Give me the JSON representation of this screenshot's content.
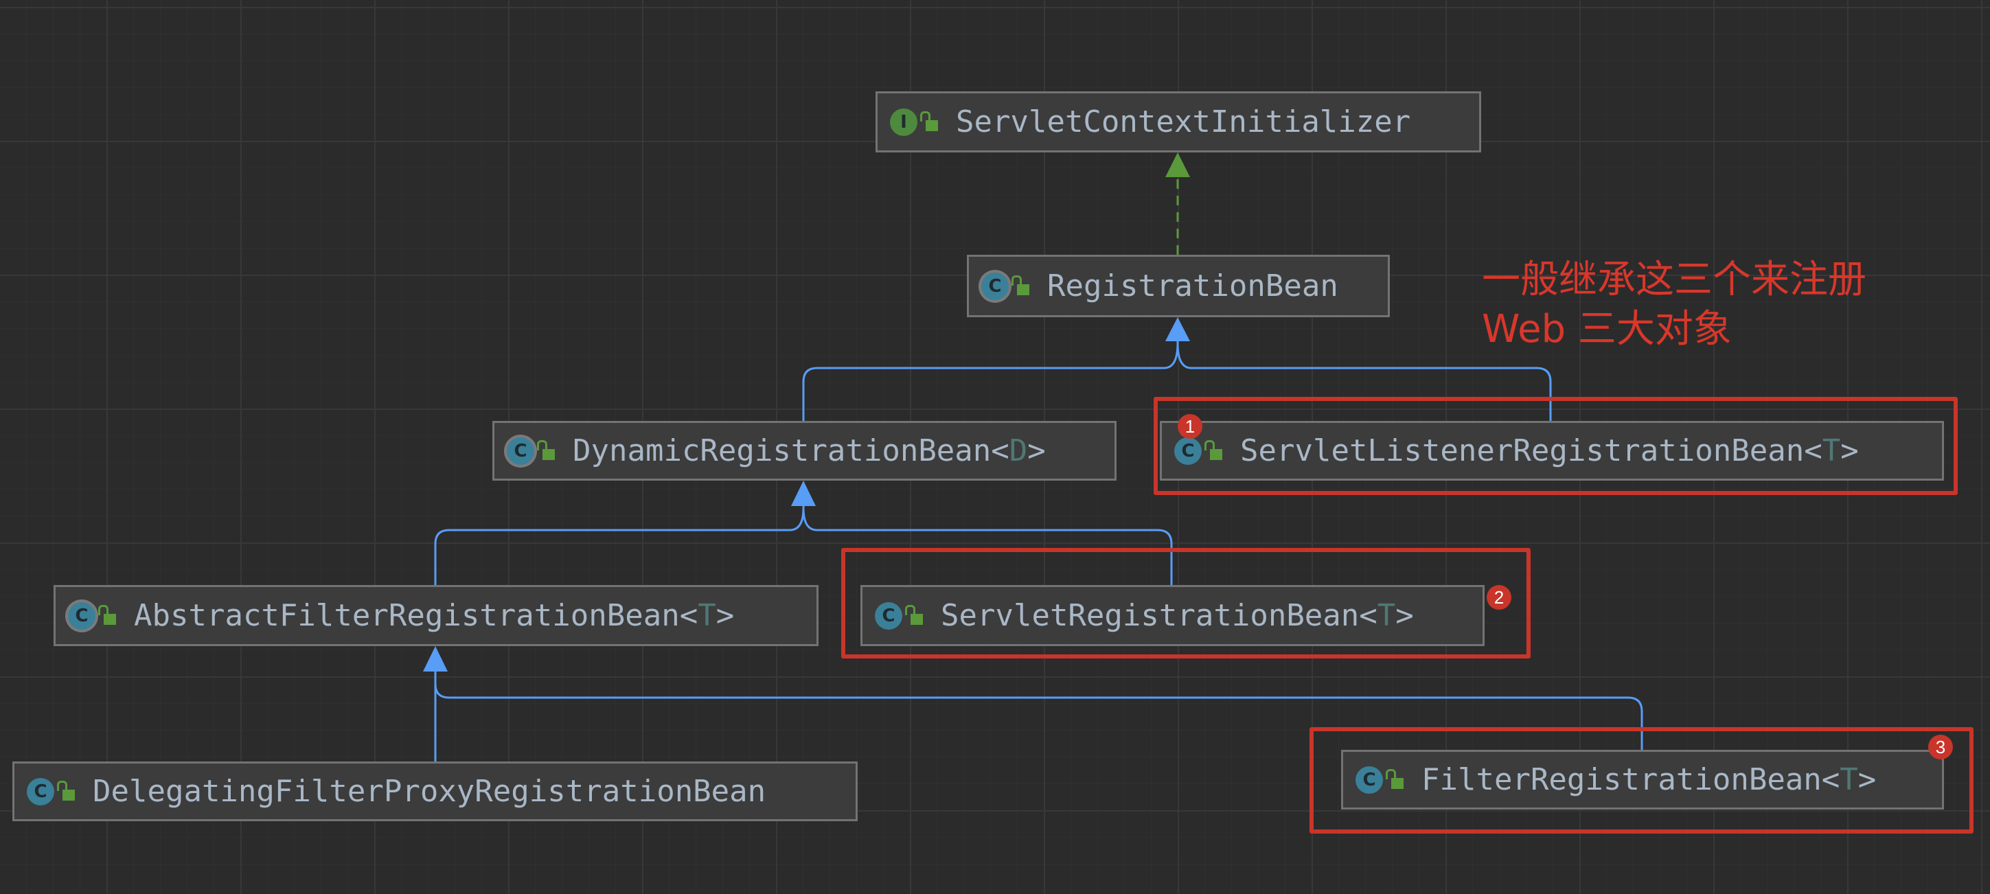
{
  "nodes": {
    "servlet_context_initializer": {
      "name": "ServletContextInitializer",
      "kind": "interface",
      "icon_letter": "I"
    },
    "registration_bean": {
      "name": "RegistrationBean",
      "kind": "abstract-class",
      "icon_letter": "C"
    },
    "dynamic_registration_bean": {
      "name": "DynamicRegistrationBean",
      "generic_open": "<",
      "generic": "D",
      "generic_close": ">",
      "kind": "abstract-class",
      "icon_letter": "C"
    },
    "servlet_listener_registration_bean": {
      "name": "ServletListenerRegistrationBean",
      "generic_open": "<",
      "generic": "T",
      "generic_close": ">",
      "kind": "class",
      "icon_letter": "C"
    },
    "abstract_filter_registration_bean": {
      "name": "AbstractFilterRegistrationBean",
      "generic_open": "<",
      "generic": "T",
      "generic_close": ">",
      "kind": "abstract-class",
      "icon_letter": "C"
    },
    "servlet_registration_bean": {
      "name": "ServletRegistrationBean",
      "generic_open": "<",
      "generic": "T",
      "generic_close": ">",
      "kind": "class",
      "icon_letter": "C"
    },
    "delegating_filter_proxy_registration_bean": {
      "name": "DelegatingFilterProxyRegistrationBean",
      "kind": "class",
      "icon_letter": "C"
    },
    "filter_registration_bean": {
      "name": "FilterRegistrationBean",
      "generic_open": "<",
      "generic": "T",
      "generic_close": ">",
      "kind": "class",
      "icon_letter": "C"
    }
  },
  "edges": [
    {
      "from": "RegistrationBean",
      "to": "ServletContextInitializer",
      "type": "implements"
    },
    {
      "from": "DynamicRegistrationBean",
      "to": "RegistrationBean",
      "type": "extends"
    },
    {
      "from": "ServletListenerRegistrationBean",
      "to": "RegistrationBean",
      "type": "extends"
    },
    {
      "from": "AbstractFilterRegistrationBean",
      "to": "DynamicRegistrationBean",
      "type": "extends"
    },
    {
      "from": "ServletRegistrationBean",
      "to": "DynamicRegistrationBean",
      "type": "extends"
    },
    {
      "from": "DelegatingFilterProxyRegistrationBean",
      "to": "AbstractFilterRegistrationBean",
      "type": "extends"
    },
    {
      "from": "FilterRegistrationBean",
      "to": "AbstractFilterRegistrationBean",
      "type": "extends"
    }
  ],
  "annotation": {
    "line1": "一般继承这三个来注册",
    "line2": "Web 三大对象"
  },
  "badges": [
    "1",
    "2",
    "3"
  ],
  "colors": {
    "background": "#2b2b2b",
    "extends_arrow": "#589df6",
    "implements_arrow": "#5a9a3a",
    "highlight": "#c9352a",
    "text": "#a9b7c6"
  }
}
